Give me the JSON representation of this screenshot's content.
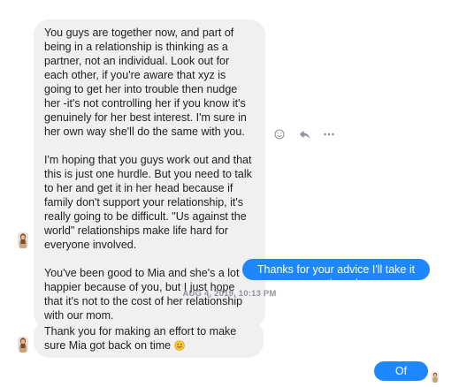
{
  "messages": {
    "first": {
      "paragraphs": [
        "You guys are together now, and part of being in a relationship is thinking as a partner, not an individual. Look out for each other, if you're aware that xyz is going to get her into trouble then nudge her -it's not controlling her if you know it's genuinely for her best interest. I'm sure in her own way she'll do the same with you.",
        "I'm hoping that you guys work out and that this is just one hurdle. But you need to talk to her and get it in her head because if family don't support your relationship, it's really going to be difficult. \"Us against the world\" relationships make life hard for everyone involved.",
        "You've been good to Mia and she's a lot happier because of you, but I just hope that it's not to the cost of her relationship with our mom."
      ]
    },
    "reply1": "Thanks for your advice I'll take it on board",
    "timestamp": "AUG 4, 2019, 10:13 PM",
    "second": "Thank you for making an effort to make sure Mia got back on time",
    "reply2": "Of course"
  },
  "icons": {
    "react": "smiley-icon",
    "reply": "reply-arrow-icon",
    "more": "more-dots-icon",
    "emoji": "slightly-smiling-face-emoji"
  },
  "colors": {
    "incoming_bubble": "#f1f0f0",
    "outgoing_bubble": "#1e86ff",
    "timestamp": "#90949c"
  }
}
